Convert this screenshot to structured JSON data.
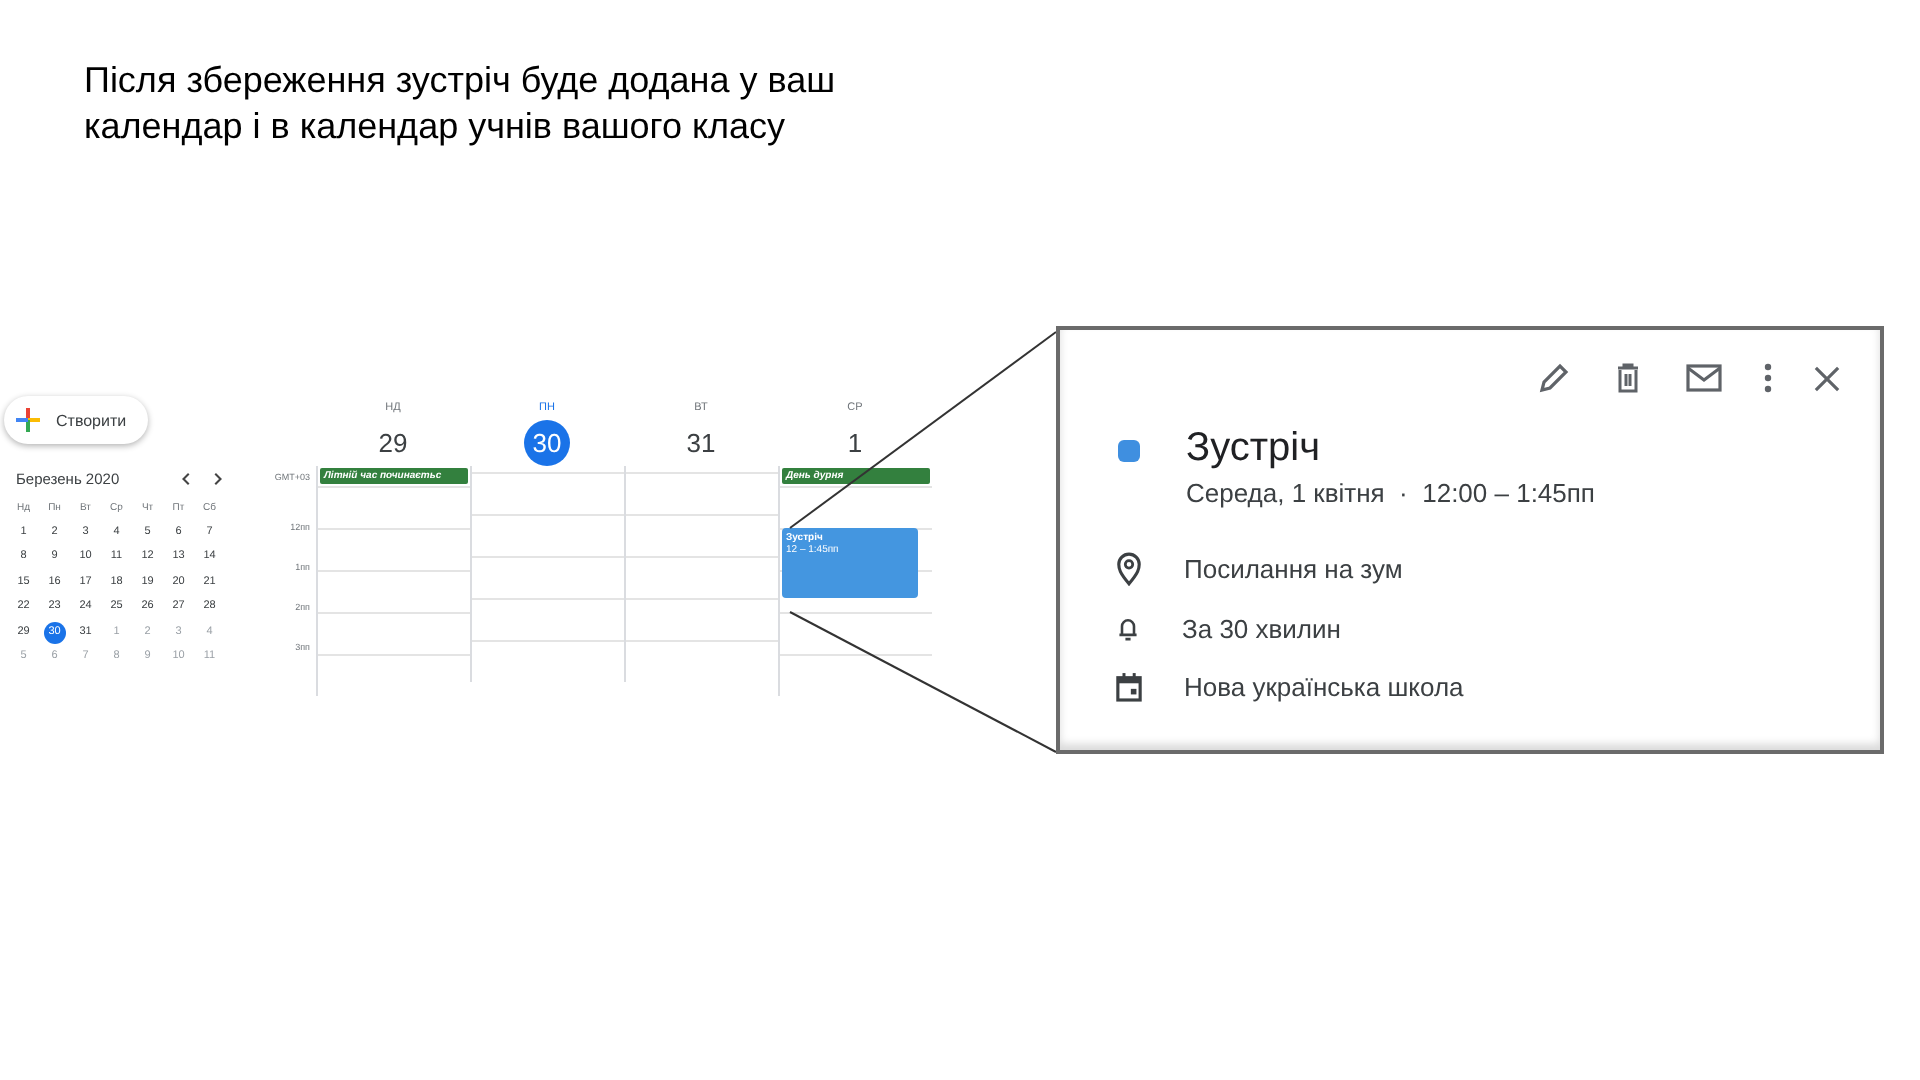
{
  "caption": "Після збереження зустріч буде додана у ваш календар і в календар учнів вашого класу",
  "sidebar": {
    "create_button": "Створити",
    "month": "Березень 2020",
    "weekdays": [
      "Нд",
      "Пн",
      "Вт",
      "Ср",
      "Чт",
      "Пт",
      "Сб"
    ],
    "days": [
      {
        "day": "1",
        "in_month": true,
        "selected": false
      },
      {
        "day": "2",
        "in_month": true,
        "selected": false
      },
      {
        "day": "3",
        "in_month": true,
        "selected": false
      },
      {
        "day": "4",
        "in_month": true,
        "selected": false
      },
      {
        "day": "5",
        "in_month": true,
        "selected": false
      },
      {
        "day": "6",
        "in_month": true,
        "selected": false
      },
      {
        "day": "7",
        "in_month": true,
        "selected": false
      },
      {
        "day": "8",
        "in_month": true,
        "selected": false
      },
      {
        "day": "9",
        "in_month": true,
        "selected": false
      },
      {
        "day": "10",
        "in_month": true,
        "selected": false
      },
      {
        "day": "11",
        "in_month": true,
        "selected": false
      },
      {
        "day": "12",
        "in_month": true,
        "selected": false
      },
      {
        "day": "13",
        "in_month": true,
        "selected": false
      },
      {
        "day": "14",
        "in_month": true,
        "selected": false
      },
      {
        "day": "15",
        "in_month": true,
        "selected": false
      },
      {
        "day": "16",
        "in_month": true,
        "selected": false
      },
      {
        "day": "17",
        "in_month": true,
        "selected": false
      },
      {
        "day": "18",
        "in_month": true,
        "selected": false
      },
      {
        "day": "19",
        "in_month": true,
        "selected": false
      },
      {
        "day": "20",
        "in_month": true,
        "selected": false
      },
      {
        "day": "21",
        "in_month": true,
        "selected": false
      },
      {
        "day": "22",
        "in_month": true,
        "selected": false
      },
      {
        "day": "23",
        "in_month": true,
        "selected": false
      },
      {
        "day": "24",
        "in_month": true,
        "selected": false
      },
      {
        "day": "25",
        "in_month": true,
        "selected": false
      },
      {
        "day": "26",
        "in_month": true,
        "selected": false
      },
      {
        "day": "27",
        "in_month": true,
        "selected": false
      },
      {
        "day": "28",
        "in_month": true,
        "selected": false
      },
      {
        "day": "29",
        "in_month": true,
        "selected": false
      },
      {
        "day": "30",
        "in_month": true,
        "selected": true
      },
      {
        "day": "31",
        "in_month": true,
        "selected": false
      },
      {
        "day": "1",
        "in_month": false,
        "selected": false
      },
      {
        "day": "2",
        "in_month": false,
        "selected": false
      },
      {
        "day": "3",
        "in_month": false,
        "selected": false
      },
      {
        "day": "4",
        "in_month": false,
        "selected": false
      },
      {
        "day": "5",
        "in_month": false,
        "selected": false
      },
      {
        "day": "6",
        "in_month": false,
        "selected": false
      },
      {
        "day": "7",
        "in_month": false,
        "selected": false
      },
      {
        "day": "8",
        "in_month": false,
        "selected": false
      },
      {
        "day": "9",
        "in_month": false,
        "selected": false
      },
      {
        "day": "10",
        "in_month": false,
        "selected": false
      },
      {
        "day": "11",
        "in_month": false,
        "selected": false
      }
    ]
  },
  "week": {
    "timezone": "GMT+03",
    "hours": [
      "12пп",
      "1пп",
      "2пп",
      "3пп"
    ],
    "columns": [
      {
        "weekday": "НД",
        "date": "29",
        "selected": false,
        "all_day": "Літній час починаєтьс"
      },
      {
        "weekday": "ПН",
        "date": "30",
        "selected": true
      },
      {
        "weekday": "ВТ",
        "date": "31",
        "selected": false
      },
      {
        "weekday": "СР",
        "date": "1",
        "selected": false,
        "all_day": "День дурня",
        "events": [
          {
            "title": "Зустріч",
            "time": "12 – 1:45пп"
          }
        ]
      }
    ]
  },
  "popup": {
    "title": "Зустріч",
    "date_line": "Середа, 1 квітня  ·  12:00 – 1:45пп",
    "details": [
      {
        "kind": "location",
        "text": "Посилання на зум"
      },
      {
        "kind": "reminder",
        "text": "За 30 хвилин"
      },
      {
        "kind": "calendar",
        "text": "Нова українська школа"
      }
    ]
  }
}
